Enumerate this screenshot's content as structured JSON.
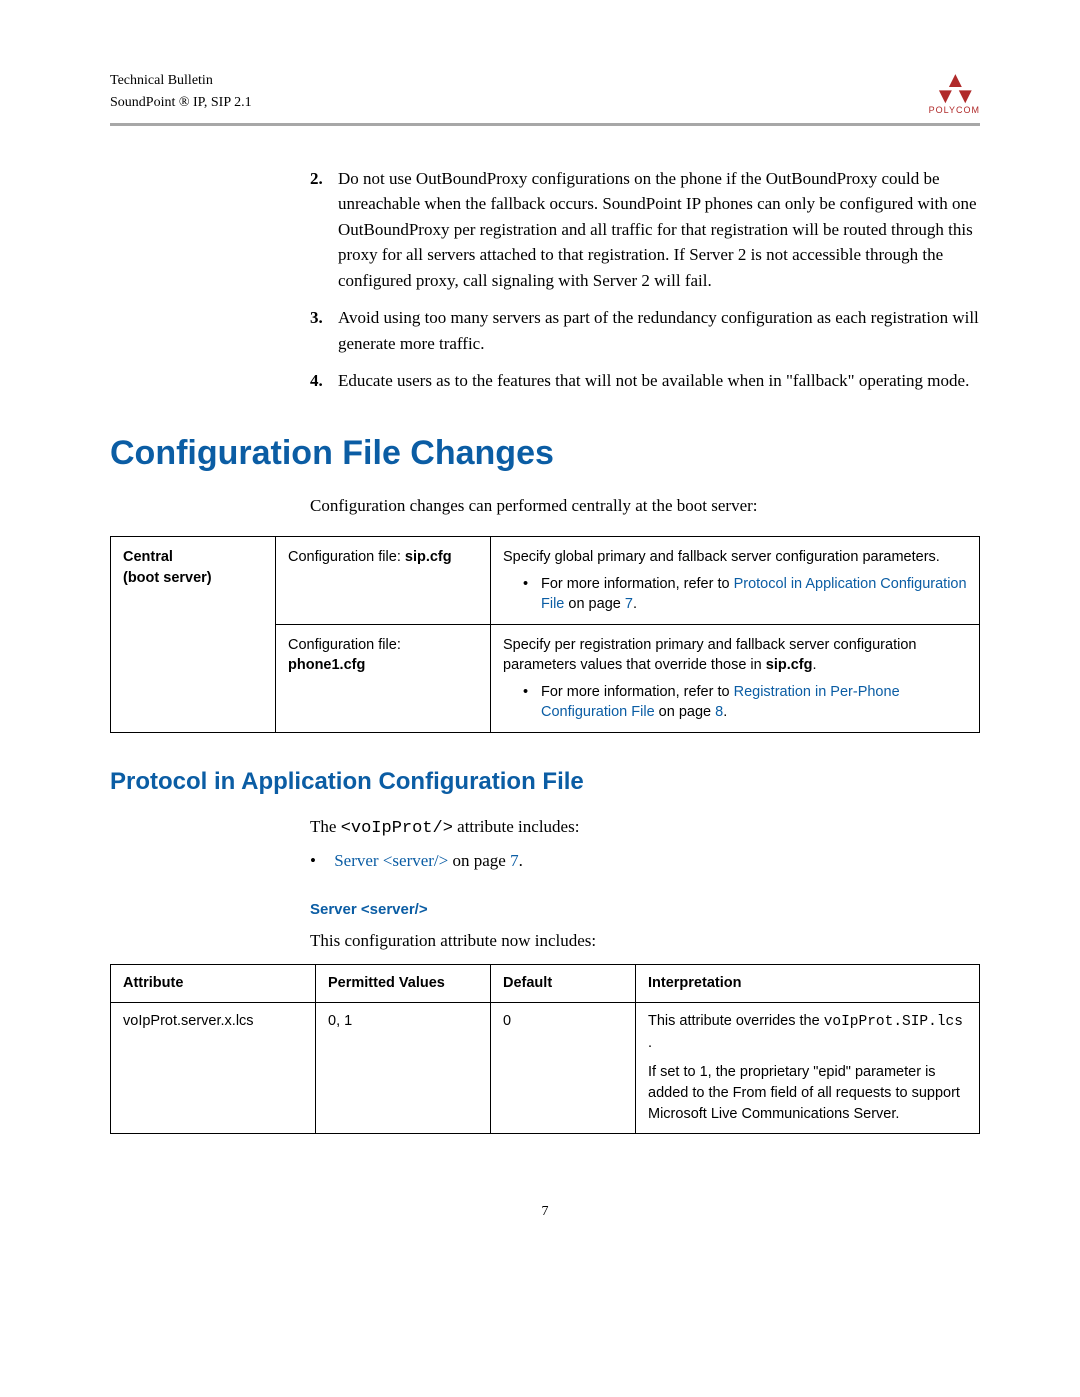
{
  "header": {
    "line1": "Technical Bulletin",
    "line2": "SoundPoint ® IP, SIP 2.1",
    "brand": "POLYCOM"
  },
  "list": {
    "item2": "Do not use OutBoundProxy configurations on the phone if the OutBoundProxy could be unreachable when the fallback occurs. SoundPoint IP phones can only be configured with one OutBoundProxy per registration and all traffic for that registration will be routed through this proxy for all servers attached to that registration. If Server 2 is not accessible through the configured proxy, call signaling with Server 2 will fail.",
    "item3": "Avoid using too many servers as part of the redundancy configuration as each registration will generate more traffic.",
    "item4": "Educate users as to the features that will not be available when in \"fallback\" operating mode."
  },
  "h1": "Configuration File Changes",
  "intro": "Configuration changes can performed centrally at the boot server:",
  "cfgTable": {
    "col1a": "Central",
    "col1b": "(boot server)",
    "r1c2a": "Configuration file: ",
    "r1c2b": "sip.cfg",
    "r1c3a": "Specify global primary and fallback server configuration parameters.",
    "r1c3b_pre": "For more information, refer to ",
    "r1c3b_link": "Protocol in Application Configuration File",
    "r1c3b_post": " on page ",
    "r1c3b_page": "7",
    "r2c2a": "Configuration file:",
    "r2c2b": "phone1.cfg",
    "r2c3a_pre": "Specify per registration primary and fallback server configuration parameters values that override those in ",
    "r2c3a_bold": "sip.cfg",
    "r2c3b_pre": "For more information, refer to ",
    "r2c3b_link": "Registration in Per-Phone Configuration File",
    "r2c3b_post": " on page ",
    "r2c3b_page": "8"
  },
  "h2": "Protocol in Application Configuration File",
  "proto_intro_pre": "The ",
  "proto_intro_code": "<voIpProt/>",
  "proto_intro_post": " attribute includes:",
  "proto_bullet_link": "Server <server/>",
  "proto_bullet_post": " on page ",
  "proto_bullet_page": "7",
  "h3": "Server <server/>",
  "attr_intro": "This configuration attribute now includes:",
  "attrTable": {
    "h1": "Attribute",
    "h2": "Permitted Values",
    "h3": "Default",
    "h4": "Interpretation",
    "r1c1": "voIpProt.server.x.lcs",
    "r1c2": "0, 1",
    "r1c3": "0",
    "r1c4a": "This attribute overrides the ",
    "r1c4code": "voIpProt.SIP.lcs",
    "r1c4dot": " .",
    "r1c4b": "If set to 1, the proprietary \"epid\" parameter is added to the From field of all requests to support Microsoft Live Communications Server."
  },
  "pagenum": "7"
}
